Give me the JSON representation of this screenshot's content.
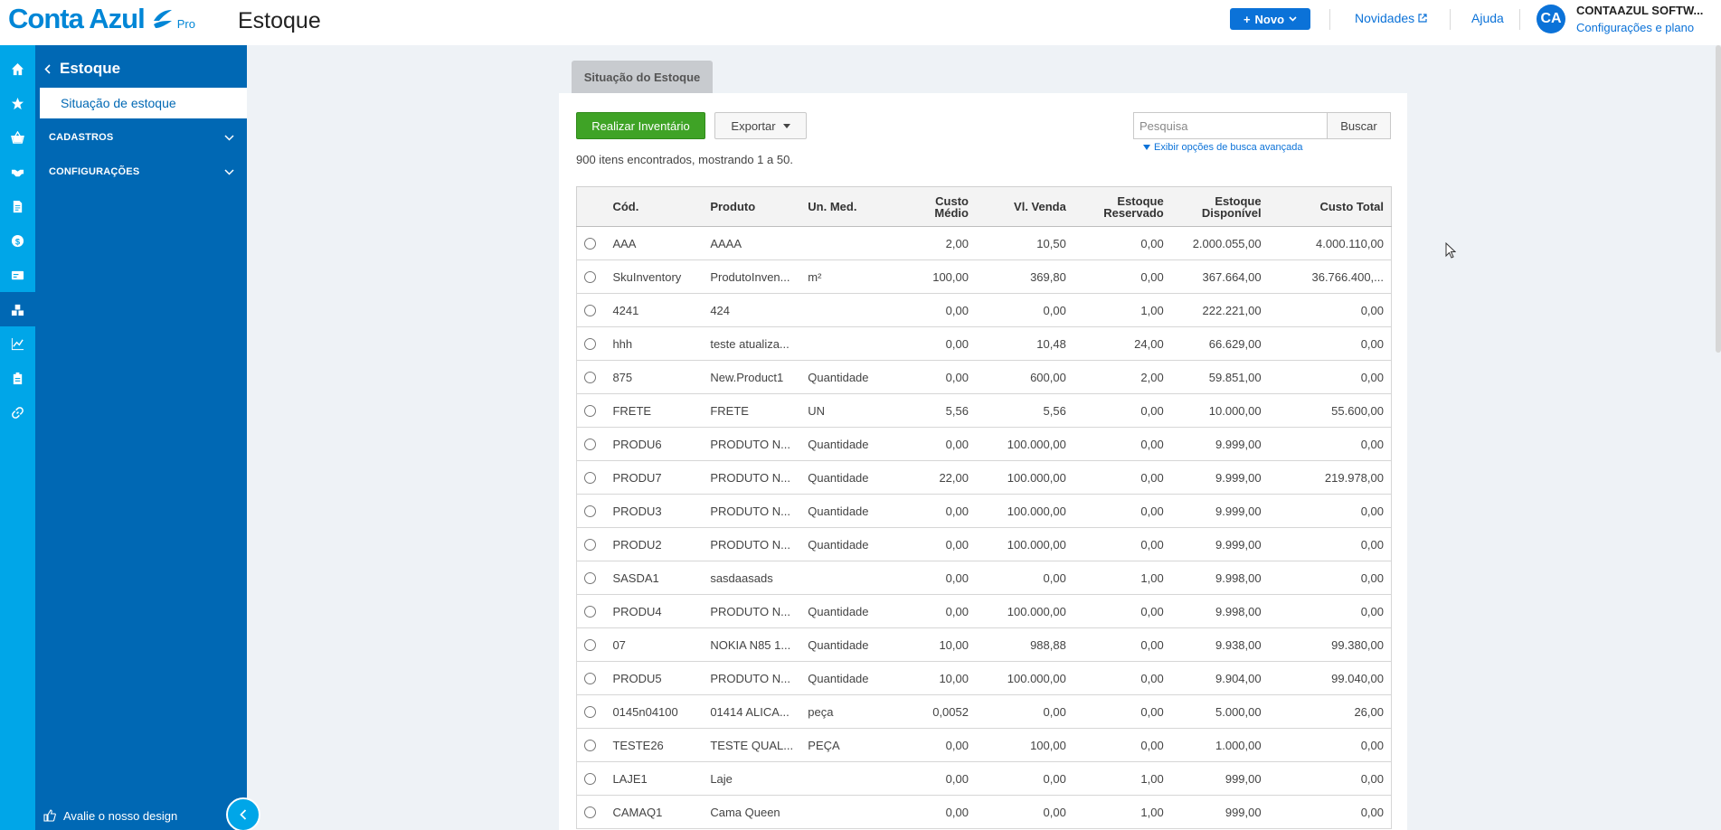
{
  "header": {
    "logo_text": "Conta Azul",
    "logo_suffix": "Pro",
    "page_title": "Estoque",
    "novo_label": "Novo",
    "novidades_label": "Novidades",
    "ajuda_label": "Ajuda",
    "avatar_initials": "CA",
    "company_name": "CONTAAZUL SOFTW...",
    "company_link": "Configurações e plano"
  },
  "rail": {
    "icons": [
      "home-icon",
      "star-icon",
      "basket-icon",
      "handshake-icon",
      "document-icon",
      "dollar-icon",
      "card-icon",
      "boxes-icon",
      "chart-icon",
      "clipboard-icon",
      "link-icon"
    ],
    "active_index": 7
  },
  "menu": {
    "title": "Estoque",
    "active_item": "Situação de estoque",
    "groups": [
      "CADASTROS",
      "CONFIGURAÇÕES"
    ],
    "footer": "Avalie o nosso design"
  },
  "content": {
    "tab_label": "Situação do Estoque",
    "inventory_button": "Realizar Inventário",
    "export_button": "Exportar",
    "search_placeholder": "Pesquisa",
    "search_button": "Buscar",
    "advanced_link": "Exibir opções de busca avançada",
    "count_text": "900 itens encontrados, mostrando 1 a 50."
  },
  "table": {
    "columns": {
      "cod": "Cód.",
      "produto": "Produto",
      "un": "Un. Med.",
      "custo_medio_1": "Custo",
      "custo_medio_2": "Médio",
      "vl_venda": "Vl. Venda",
      "reservado_1": "Estoque",
      "reservado_2": "Reservado",
      "disponivel_1": "Estoque",
      "disponivel_2": "Disponível",
      "custo_total": "Custo Total"
    },
    "rows": [
      {
        "cod": "AAA",
        "produto": "AAAA",
        "un": "",
        "custo": "2,00",
        "venda": "10,50",
        "reservado": "0,00",
        "disponivel": "2.000.055,00",
        "total": "4.000.110,00"
      },
      {
        "cod": "SkuInventory",
        "produto": "ProdutoInven...",
        "un": "m²",
        "custo": "100,00",
        "venda": "369,80",
        "reservado": "0,00",
        "disponivel": "367.664,00",
        "total": "36.766.400,..."
      },
      {
        "cod": "4241",
        "produto": "424",
        "un": "",
        "custo": "0,00",
        "venda": "0,00",
        "reservado": "1,00",
        "disponivel": "222.221,00",
        "total": "0,00"
      },
      {
        "cod": "hhh",
        "produto": "teste atualiza...",
        "un": "",
        "custo": "0,00",
        "venda": "10,48",
        "reservado": "24,00",
        "disponivel": "66.629,00",
        "total": "0,00"
      },
      {
        "cod": "875",
        "produto": "New.Product1",
        "un": "Quantidade",
        "custo": "0,00",
        "venda": "600,00",
        "reservado": "2,00",
        "disponivel": "59.851,00",
        "total": "0,00"
      },
      {
        "cod": "FRETE",
        "produto": "FRETE",
        "un": "UN",
        "custo": "5,56",
        "venda": "5,56",
        "reservado": "0,00",
        "disponivel": "10.000,00",
        "total": "55.600,00"
      },
      {
        "cod": "PRODU6",
        "produto": "PRODUTO N...",
        "un": "Quantidade",
        "custo": "0,00",
        "venda": "100.000,00",
        "reservado": "0,00",
        "disponivel": "9.999,00",
        "total": "0,00"
      },
      {
        "cod": "PRODU7",
        "produto": "PRODUTO N...",
        "un": "Quantidade",
        "custo": "22,00",
        "venda": "100.000,00",
        "reservado": "0,00",
        "disponivel": "9.999,00",
        "total": "219.978,00"
      },
      {
        "cod": "PRODU3",
        "produto": "PRODUTO N...",
        "un": "Quantidade",
        "custo": "0,00",
        "venda": "100.000,00",
        "reservado": "0,00",
        "disponivel": "9.999,00",
        "total": "0,00"
      },
      {
        "cod": "PRODU2",
        "produto": "PRODUTO N...",
        "un": "Quantidade",
        "custo": "0,00",
        "venda": "100.000,00",
        "reservado": "0,00",
        "disponivel": "9.999,00",
        "total": "0,00"
      },
      {
        "cod": "SASDA1",
        "produto": "sasdaasads",
        "un": "",
        "custo": "0,00",
        "venda": "0,00",
        "reservado": "1,00",
        "disponivel": "9.998,00",
        "total": "0,00"
      },
      {
        "cod": "PRODU4",
        "produto": "PRODUTO N...",
        "un": "Quantidade",
        "custo": "0,00",
        "venda": "100.000,00",
        "reservado": "0,00",
        "disponivel": "9.998,00",
        "total": "0,00"
      },
      {
        "cod": "07",
        "produto": "NOKIA N85 1...",
        "un": "Quantidade",
        "custo": "10,00",
        "venda": "988,88",
        "reservado": "0,00",
        "disponivel": "9.938,00",
        "total": "99.380,00"
      },
      {
        "cod": "PRODU5",
        "produto": "PRODUTO N...",
        "un": "Quantidade",
        "custo": "10,00",
        "venda": "100.000,00",
        "reservado": "0,00",
        "disponivel": "9.904,00",
        "total": "99.040,00"
      },
      {
        "cod": "0145n04100",
        "produto": "01414 ALICA...",
        "un": "peça",
        "custo": "0,0052",
        "venda": "0,00",
        "reservado": "0,00",
        "disponivel": "5.000,00",
        "total": "26,00"
      },
      {
        "cod": "TESTE26",
        "produto": "TESTE QUAL...",
        "un": "PEÇA",
        "custo": "0,00",
        "venda": "100,00",
        "reservado": "0,00",
        "disponivel": "1.000,00",
        "total": "0,00"
      },
      {
        "cod": "LAJE1",
        "produto": "Laje",
        "un": "",
        "custo": "0,00",
        "venda": "0,00",
        "reservado": "1,00",
        "disponivel": "999,00",
        "total": "0,00"
      },
      {
        "cod": "CAMAQ1",
        "produto": "Cama Queen",
        "un": "",
        "custo": "0,00",
        "venda": "0,00",
        "reservado": "1,00",
        "disponivel": "999,00",
        "total": "0,00"
      }
    ]
  },
  "colors": {
    "brand_blue": "#0086d6",
    "rail_blue": "#00a6e8",
    "menu_blue": "#0068b4",
    "action_blue": "#0b72d8",
    "success_green": "#3fa326"
  }
}
